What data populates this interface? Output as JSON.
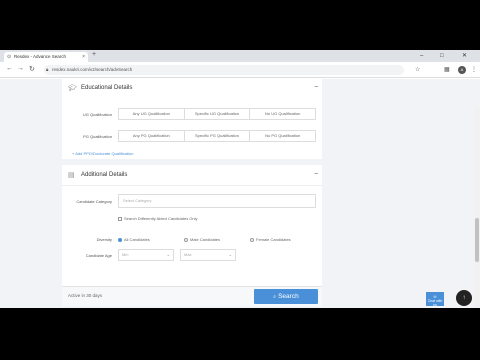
{
  "browser": {
    "tab_title": "Resdex - Advance Search",
    "url": "resdex.naukri.com/v2/search/advSearch",
    "new_tab": "+",
    "min": "–",
    "max": "□",
    "close": "✕",
    "avatar_initial": "A"
  },
  "educational": {
    "title": "Educational Details",
    "collapse": "–",
    "ug_label": "UG Qualification",
    "ug_options": [
      "Any UG Qualification",
      "Specific UG Qualification",
      "No UG Qualification"
    ],
    "pg_label": "PG Qualification",
    "pg_options": [
      "Any PG Qualification",
      "Specific PG Qualification",
      "No PG Qualification"
    ],
    "add_ppg": "+ Add PPG/Doctorate Qualification"
  },
  "additional": {
    "title": "Additional Details",
    "collapse": "–",
    "category_label": "Candidate Category",
    "category_placeholder": "Select Category",
    "diff_abled": "Search Differently Abled Candidates Only",
    "gender_label": "Diversity",
    "gender_options": [
      "All Candidates",
      "Male Candidates",
      "Female Candidates"
    ],
    "age_label": "Candidate Age",
    "age_min": "Min",
    "age_max": "Max"
  },
  "footer": {
    "active_in": "Active in",
    "active_value": "30 days",
    "search_label": "Search"
  },
  "help_label": "Chat with us"
}
